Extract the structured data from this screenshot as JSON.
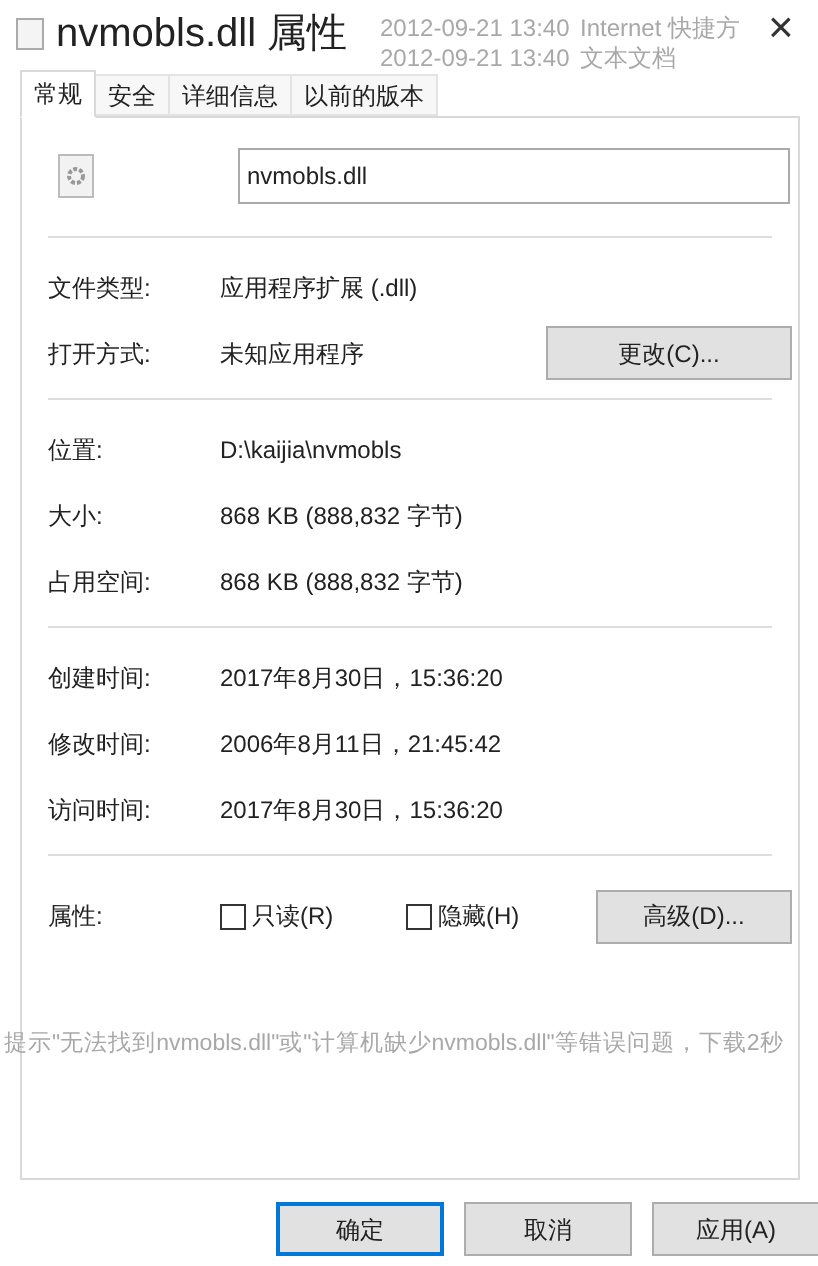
{
  "window": {
    "title": "nvmobls.dll 属性",
    "close": "×"
  },
  "background_texts": [
    "2012-09-21 13:40",
    "Internet 快捷方",
    "2012-09-21 13:40",
    "文本文档"
  ],
  "tabs": [
    {
      "label": "常规",
      "selected": true
    },
    {
      "label": "安全",
      "selected": false
    },
    {
      "label": "详细信息",
      "selected": false
    },
    {
      "label": "以前的版本",
      "selected": false
    }
  ],
  "file_name": {
    "value": "nvmobls.dll"
  },
  "sections": [
    [
      {
        "label": "文件类型:",
        "value": "应用程序扩展 (.dll)"
      },
      {
        "label": "打开方式:",
        "value": "未知应用程序",
        "button": "更改(C)..."
      }
    ],
    [
      {
        "label": "位置:",
        "value": "D:\\kaijia\\nvmobls"
      },
      {
        "label": "大小:",
        "value": "868 KB (888,832 字节)"
      },
      {
        "label": "占用空间:",
        "value": "868 KB (888,832 字节)"
      }
    ],
    [
      {
        "label": "创建时间:",
        "value": "2017年8月30日，15:36:20"
      },
      {
        "label": "修改时间:",
        "value": "2006年8月11日，21:45:42"
      },
      {
        "label": "访问时间:",
        "value": "2017年8月30日，15:36:20"
      }
    ]
  ],
  "attributes": {
    "label": "属性:",
    "checkboxes": [
      {
        "label": "只读(R)",
        "checked": false
      },
      {
        "label": "隐藏(H)",
        "checked": false
      }
    ],
    "button": "高级(D)..."
  },
  "background_hint": "提示\"无法找到nvmobls.dll\"或\"计算机缺少nvmobls.dll\"等错误问题，下载2秒",
  "buttons": [
    {
      "label": "确定",
      "default": true
    },
    {
      "label": "取消",
      "default": false
    },
    {
      "label": "应用(A)",
      "default": false
    }
  ]
}
